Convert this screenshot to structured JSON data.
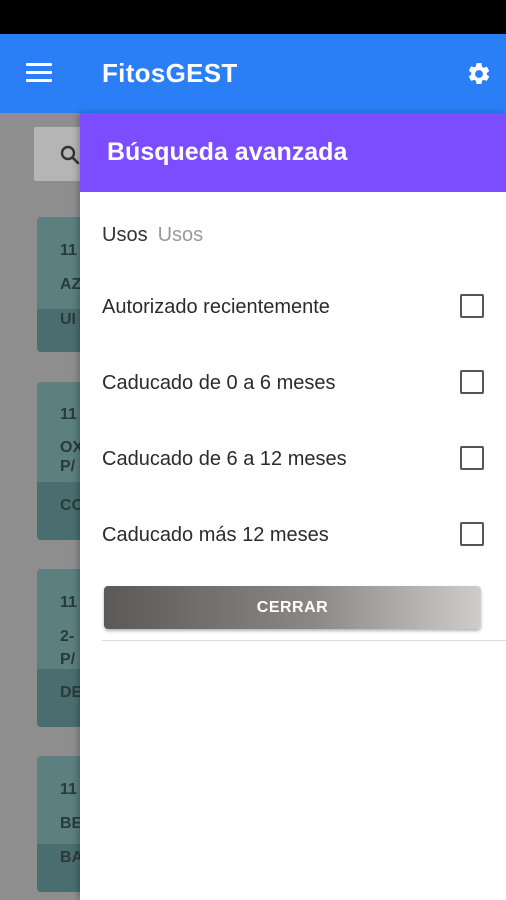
{
  "app": {
    "title": "FitosGEST"
  },
  "background": {
    "cards": [
      {
        "line1": "11",
        "line2": "AZ",
        "line3": "UI"
      },
      {
        "line1": "11",
        "line2": "OX",
        "line3": "P/",
        "line4": "CO"
      },
      {
        "line1": "11",
        "line2": "2-",
        "line3": "P/",
        "line4": "DE"
      },
      {
        "line1": "11",
        "line2": "BE",
        "line3": "BA"
      }
    ]
  },
  "drawer": {
    "title": "Búsqueda avanzada",
    "usos_label": "Usos",
    "usos_placeholder": "Usos",
    "options": [
      {
        "label": "Autorizado recientemente",
        "checked": false
      },
      {
        "label": "Caducado de 0 a 6 meses",
        "checked": false
      },
      {
        "label": "Caducado de 6 a 12 meses",
        "checked": false
      },
      {
        "label": "Caducado más 12 meses",
        "checked": false
      }
    ],
    "close_label": "CERRAR"
  }
}
